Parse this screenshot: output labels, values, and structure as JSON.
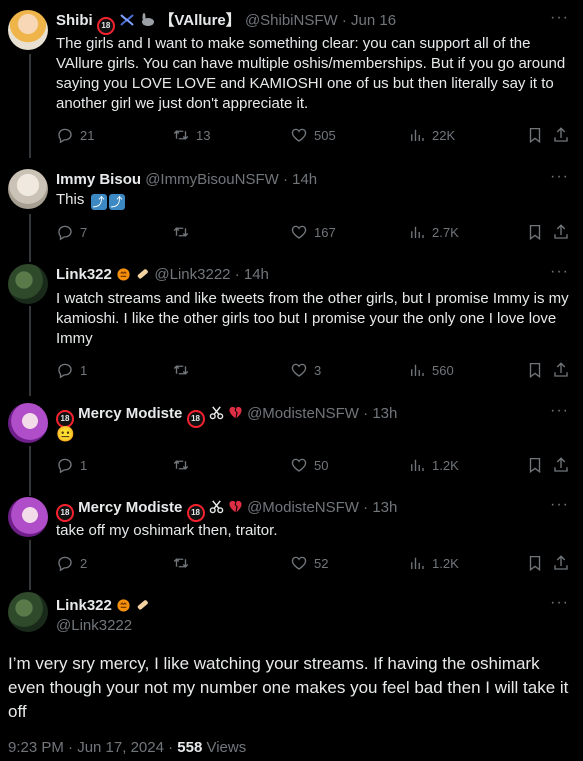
{
  "tweets": [
    {
      "display_name": "Shibi",
      "name_suffix": "【VAllure】",
      "handle": "@ShibiNSFW",
      "time": "Jun 16",
      "text": "The girls and I want to make something clear: you can support all of the VAllure girls. You can have multiple oshis/memberships. But if you go around saying you LOVE LOVE and KAMIOSHI one of us but then literally say it to another girl we just don't appreciate it.",
      "replies": "21",
      "reposts": "13",
      "likes": "505",
      "views": "22K"
    },
    {
      "display_name": "Immy Bisou",
      "handle": "@ImmyBisouNSFW",
      "time": "14h",
      "text": "This",
      "replies": "7",
      "reposts": "",
      "likes": "167",
      "views": "2.7K"
    },
    {
      "display_name": "Link322",
      "handle": "@Link3222",
      "time": "14h",
      "text": "I watch streams and like tweets from the other girls, but I promise Immy is my kamioshi. I like the other girls too but I promise your the only one I love love Immy",
      "replies": "1",
      "reposts": "",
      "likes": "3",
      "views": "560"
    },
    {
      "display_name": "Mercy Modiste",
      "handle": "@ModisteNSFW",
      "time": "13h",
      "text": "😐",
      "replies": "1",
      "reposts": "",
      "likes": "50",
      "views": "1.2K"
    },
    {
      "display_name": "Mercy Modiste",
      "handle": "@ModisteNSFW",
      "time": "13h",
      "text": "take off my oshimark then, traitor.",
      "replies": "2",
      "reposts": "",
      "likes": "52",
      "views": "1.2K"
    }
  ],
  "main": {
    "display_name": "Link322",
    "handle": "@Link3222",
    "text": "I’m very sry mercy, I like watching your streams. If having the oshimark even though your not my number one makes you feel bad then I will take it off",
    "timestamp": "9:23 PM · Jun 17, 2024 · ",
    "views_count": "558",
    "views_label": "Views"
  },
  "separator": "·",
  "more_glyph": "···",
  "badge_text": "18",
  "colors": {
    "background": "#000000",
    "text": "#e7e9ea",
    "muted": "#71767b",
    "thread_line": "#333639",
    "badge_red": "#f4212e"
  }
}
